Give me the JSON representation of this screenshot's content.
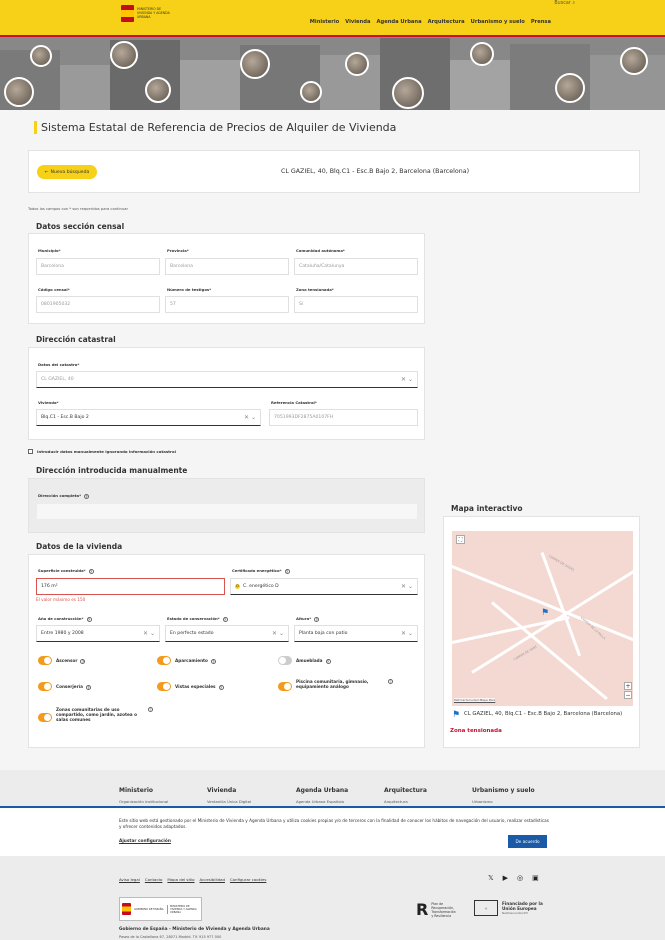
{
  "header": {
    "ministry_text": "MINISTERIO DE VIVIENDA Y AGENDA URBANA",
    "search_label": "Buscar",
    "nav": [
      "Ministerio",
      "Vivienda",
      "Agenda Urbana",
      "Arquitectura",
      "Urbanismo y suelo",
      "Prensa"
    ],
    "accent_color": "#f7d117",
    "brand_red": "#c8102e"
  },
  "page": {
    "title": "Sistema Estatal de Referencia de Precios de Alquiler de Vivienda",
    "new_search_label": "Nueva búsqueda",
    "address": "CL GAZIEL, 40, Blq.C1 - Esc.B Bajo 2, Barcelona (Barcelona)",
    "required_note": "Todos los campos con * son requeridos para continuar"
  },
  "census": {
    "title": "Datos sección censal",
    "municipio_label": "Municipio*",
    "municipio": "Barcelona",
    "provincia_label": "Provincia*",
    "provincia": "Barcelona",
    "comunidad_label": "Comunidad autónoma*",
    "comunidad": "Cataluña/Catalunya",
    "codigo_label": "Código censal*",
    "codigo": "0801905032",
    "testigos_label": "Número de testigos*",
    "testigos": "57",
    "zona_label": "Zona tensionada*",
    "zona": "Sí"
  },
  "catastro": {
    "title": "Dirección catastral",
    "datos_label": "Datos del catastro*",
    "datos": "CL GAZIEL, 40",
    "vivienda_label": "Vivienda*",
    "vivienda": "Blq.C1 - Esc.B Bajo 2",
    "ref_label": "Referencia Catastral*",
    "ref": "7051993DF2875A0107FH",
    "manual_check": "Introducir datos manualmente ignorando información catastral"
  },
  "manual": {
    "title": "Dirección introducida manualmente",
    "completa_label": "Dirección completa*"
  },
  "vivienda": {
    "title": "Datos de la vivienda",
    "superficie_label": "Superficie construida*",
    "superficie": "176  m²",
    "superficie_error": "El valor máximo es 150",
    "cert_label": "Certificado energético*",
    "cert": "C. energético D",
    "cert_badge": "D",
    "anio_label": "Año de construcción*",
    "anio": "Entre 1980 y 2008",
    "estado_label": "Estado de conservación*",
    "estado": "En perfecto estado",
    "altura_label": "Altura*",
    "altura": "Planta baja con patio",
    "toggles": [
      {
        "label": "Ascensor",
        "on": true
      },
      {
        "label": "Aparcamiento",
        "on": true
      },
      {
        "label": "Amueblada",
        "on": false
      },
      {
        "label": "Conserjería",
        "on": true
      },
      {
        "label": "Vistas especiales",
        "on": true
      },
      {
        "label": "Piscina comunitaria, gimnasio, equipamiento análogo",
        "on": true
      },
      {
        "label": "Zonas comunitarias de uso compartido, como jardín, azotea o salas comunes",
        "on": true
      }
    ]
  },
  "map": {
    "title": "Mapa interactivo",
    "address": "CL GAZIEL, 40, Blq.C1 - Esc.B Bajo 2, Barcelona (Barcelona)",
    "zona": "Zona tensionada",
    "attribution": "IGN  Cartociudad  Mapa libre",
    "streets": [
      "CARRER DE GAZIEL",
      "CARRER DE LA PALLA",
      "CARRER DE SANT"
    ],
    "zoom_in": "+",
    "zoom_out": "−"
  },
  "footer": {
    "columns": [
      {
        "title": "Ministerio",
        "sub": "Organización institucional"
      },
      {
        "title": "Vivienda",
        "sub": "Ventanilla Única Digital"
      },
      {
        "title": "Agenda Urbana",
        "sub": "Agenda Urbana Española"
      },
      {
        "title": "Arquitectura",
        "sub": "Arquitectura"
      },
      {
        "title": "Urbanismo y suelo",
        "sub": "Urbanismo"
      }
    ],
    "links": [
      "Aviso legal",
      "Contacto",
      "Mapa del sitio",
      "Accesibilidad",
      "Configurar cookies"
    ],
    "gobierno": "Gobierno de España - Ministerio de Vivienda y Agenda Urbana",
    "address": "Paseo de la Castellana 67, 28071 Madrid. Tlf. 915 977 000",
    "plan_text": "Plan de Recuperación, Transformación y Resiliencia",
    "eu_text": "Financiado por la Unión Europea",
    "eu_sub": "NextGenerationEU",
    "gob_logo": "GOBIERNO DE ESPAÑA",
    "min_logo": "MINISTERIO DE VIVIENDA Y AGENDA URBANA"
  },
  "cookie": {
    "text": "Este sitio web está gestionado por el Ministerio de Vivienda y Agenda Urbana y utiliza cookies propias y/o de terceros con la finalidad de conocer los hábitos de navegación del usuario, realizar estadísticas y ofrecer contenidos adaptados.",
    "config_link": "Ajustar configuración",
    "accept": "De acuerdo"
  }
}
